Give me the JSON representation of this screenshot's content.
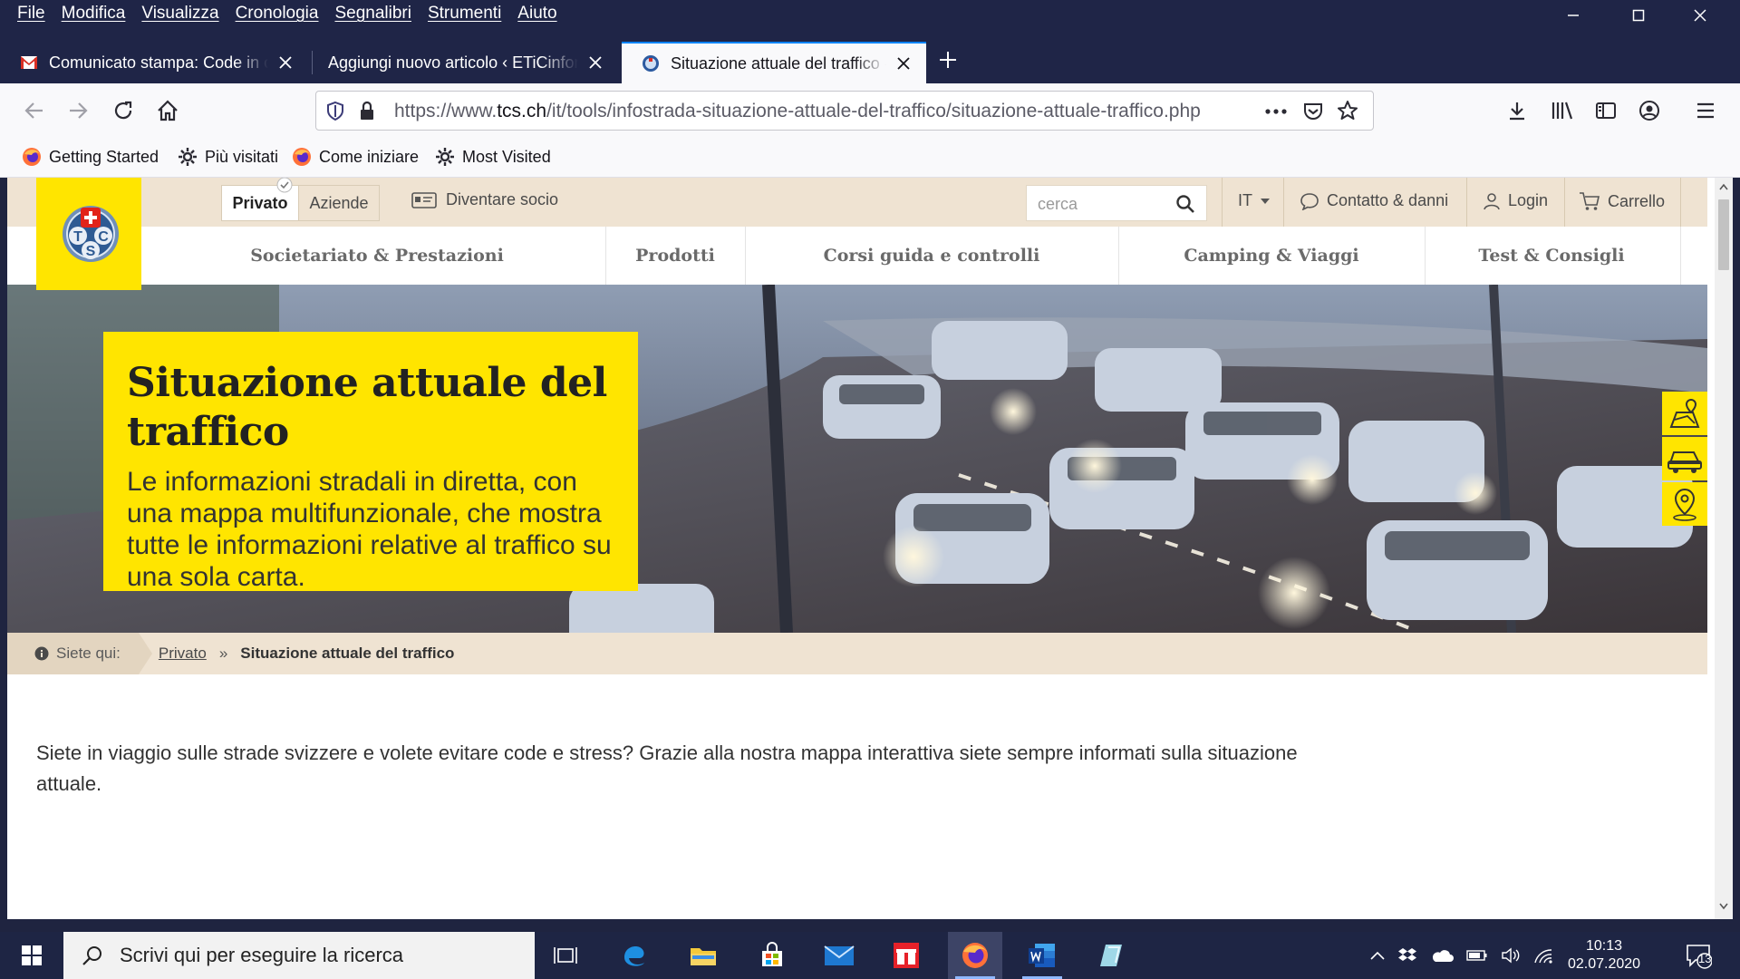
{
  "menubar": [
    "File",
    "Modifica",
    "Visualizza",
    "Cronologia",
    "Segnalibri",
    "Strumenti",
    "Aiuto"
  ],
  "tabs": [
    {
      "title": "Comunicato stampa: Code in on",
      "icon": "gmail-icon",
      "active": false
    },
    {
      "title": "Aggiungi nuovo articolo ‹ ETiCinform",
      "icon": "none",
      "active": false
    },
    {
      "title": "Situazione attuale del traffico - TCS",
      "icon": "tcs-icon",
      "active": true
    }
  ],
  "url": {
    "prefix": "https://www.",
    "domain": "tcs.ch",
    "path": "/it/tools/infostrada-situazione-attuale-del-traffico/situazione-attuale-traffico.php"
  },
  "bookmarks": [
    {
      "label": "Getting Started",
      "icon": "firefox-icon"
    },
    {
      "label": "Più visitati",
      "icon": "gear-icon"
    },
    {
      "label": "Come iniziare",
      "icon": "firefox-icon"
    },
    {
      "label": "Most Visited",
      "icon": "gear-icon"
    }
  ],
  "site": {
    "segments": {
      "privato": "Privato",
      "aziende": "Aziende"
    },
    "diventare": "Diventare socio",
    "search_placeholder": "cerca",
    "language": "IT",
    "contatto": "Contatto & danni",
    "login": "Login",
    "carrello": "Carrello",
    "mainnav": [
      "Societariato & Prestazioni",
      "Prodotti",
      "Corsi guida e controlli",
      "Camping & Viaggi",
      "Test & Consigli"
    ],
    "logo_letters": [
      "T",
      "C",
      "S"
    ]
  },
  "hero": {
    "title": "Situazione attuale del traffico",
    "subtitle": "Le informazioni stradali in diretta, con una mappa multifunzionale, che mostra tutte le informazioni relative al traffico su una sola carta."
  },
  "breadcrumb": {
    "label": "Siete qui:",
    "link": "Privato",
    "separator": "»",
    "current": "Situazione attuale del traffico"
  },
  "body": {
    "intro": "Siete in viaggio sulle strade svizzere e volete evitare code e stress? Grazie alla nostra mappa interattiva siete sempre informati sulla situazione attuale."
  },
  "taskbar": {
    "search_placeholder": "Scrivi qui per eseguire la ricerca",
    "time": "10:13",
    "date": "02.07.2020",
    "notifications": "13"
  },
  "colors": {
    "brand_yellow": "#ffe500",
    "chrome_dark": "#1f2547",
    "beige": "#efe3d2",
    "accent_blue": "#0a84ff"
  }
}
